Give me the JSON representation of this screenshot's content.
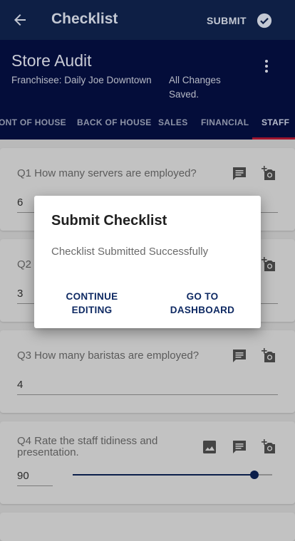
{
  "appbar": {
    "title": "Checklist",
    "submit_label": "SUBMIT"
  },
  "header": {
    "title": "Store Audit",
    "franchisee": "Franchisee: Daily Joe Downtown",
    "changes_status": "All Changes Saved."
  },
  "tabs": [
    {
      "label": "ONT OF HOUSE"
    },
    {
      "label": "BACK OF HOUSE"
    },
    {
      "label": "SALES"
    },
    {
      "label": "FINANCIAL"
    },
    {
      "label": "STAFF",
      "active": true
    }
  ],
  "questions": [
    {
      "text": "Q1 How many servers are employed?",
      "answer": "6"
    },
    {
      "text": "Q2",
      "answer": "3"
    },
    {
      "text": "Q3 How many baristas are employed?",
      "answer": "4"
    },
    {
      "text": "Q4 Rate the staff tidiness and presentation.",
      "answer": "90",
      "slider_fraction": 0.91
    }
  ],
  "dialog": {
    "title": "Submit Checklist",
    "message": "Checklist Submitted Successfully",
    "continue_label": "CONTINUE EDITING",
    "dashboard_label": "GO TO DASHBOARD"
  },
  "colors": {
    "appbar": "#0e1f45",
    "header": "#040d3a",
    "tab_indicator": "#a0152e",
    "accent": "#0b1e4a",
    "dialog_button": "#0f2a63"
  }
}
